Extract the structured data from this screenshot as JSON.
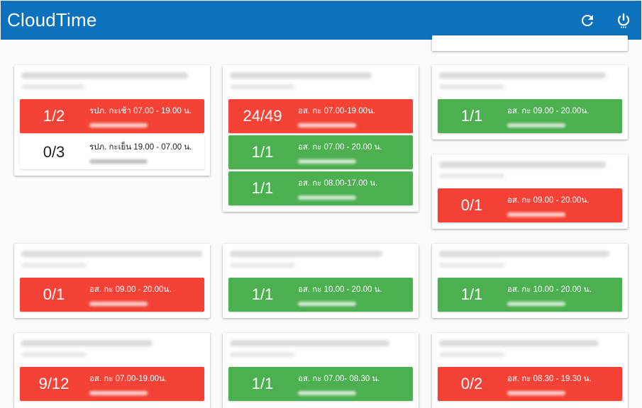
{
  "app": {
    "title": "CloudTime",
    "refresh_icon": "refresh-icon",
    "power_icon": "power-icon"
  },
  "colors": {
    "appbar": "#0d72bd",
    "red": "#f44336",
    "green": "#4caf50"
  },
  "columns": [
    [
      {
        "shifts": [
          {
            "count": "1/2",
            "label": "รปภ. กะเช้า 07.00 - 19.00 น.",
            "status": "red"
          },
          {
            "count": "0/3",
            "label": "รปภ. กะเย็น 19.00 - 07.00 น.",
            "status": "white"
          }
        ]
      },
      {
        "shifts": [
          {
            "count": "0/1",
            "label": "อส. กะ 09.00 - 20.00น.",
            "status": "red"
          }
        ]
      },
      {
        "shifts": [
          {
            "count": "9/12",
            "label": "อส. กะ 07.00-19.00น.",
            "status": "red"
          }
        ]
      }
    ],
    [
      {
        "shifts": [
          {
            "count": "24/49",
            "label": "อส. กะ 07.00-19.00น.",
            "status": "red"
          },
          {
            "count": "1/1",
            "label": "อส. กะ 07.00 - 20.00 น.",
            "status": "green"
          },
          {
            "count": "1/1",
            "label": "อส. กะ 08.00-17.00 น.",
            "status": "green"
          }
        ]
      },
      {
        "shifts": [
          {
            "count": "1/1",
            "label": "อส. กะ 10.00 - 20.00 น.",
            "status": "green"
          }
        ]
      },
      {
        "shifts": [
          {
            "count": "1/1",
            "label": "อส. กะ 07.00- 08.30 น.",
            "status": "green"
          }
        ]
      }
    ],
    [
      {
        "shifts": [
          {
            "count": "1/1",
            "label": "อส. กะ 09.00 - 20.00น.",
            "status": "green"
          }
        ]
      },
      {
        "shifts": [
          {
            "count": "0/1",
            "label": "อส. กะ 09.00 - 20.00น.",
            "status": "red"
          }
        ]
      },
      {
        "shifts": [
          {
            "count": "1/1",
            "label": "อส. กะ 10.00 - 20.00 น.",
            "status": "green"
          }
        ]
      },
      {
        "shifts": [
          {
            "count": "0/2",
            "label": "อส. กะ 08.30 - 19.30 น.",
            "status": "red"
          }
        ]
      }
    ]
  ]
}
